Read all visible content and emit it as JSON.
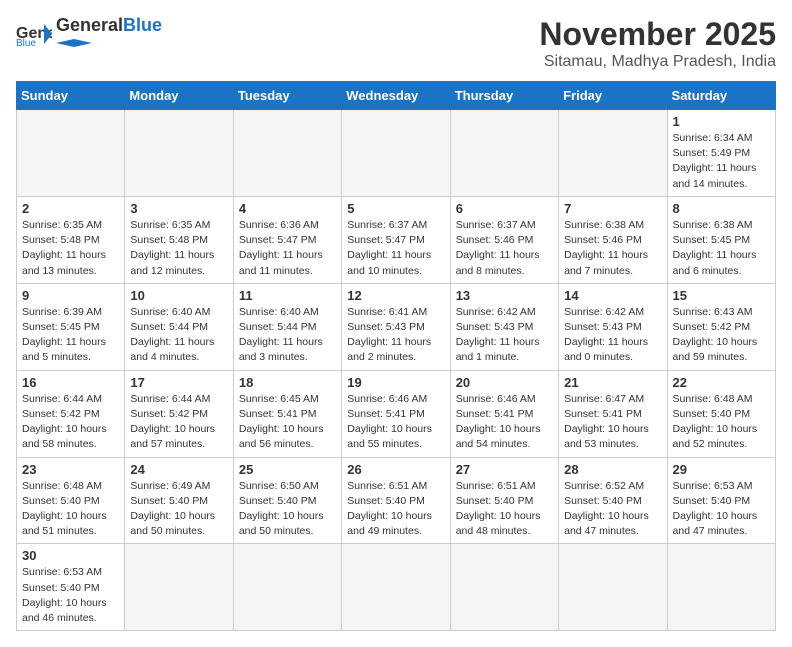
{
  "header": {
    "logo_general": "General",
    "logo_blue": "Blue",
    "month_year": "November 2025",
    "location": "Sitamau, Madhya Pradesh, India"
  },
  "weekdays": [
    "Sunday",
    "Monday",
    "Tuesday",
    "Wednesday",
    "Thursday",
    "Friday",
    "Saturday"
  ],
  "days": {
    "1": {
      "sunrise": "6:34 AM",
      "sunset": "5:49 PM",
      "daylight": "11 hours and 14 minutes."
    },
    "2": {
      "sunrise": "6:35 AM",
      "sunset": "5:48 PM",
      "daylight": "11 hours and 13 minutes."
    },
    "3": {
      "sunrise": "6:35 AM",
      "sunset": "5:48 PM",
      "daylight": "11 hours and 12 minutes."
    },
    "4": {
      "sunrise": "6:36 AM",
      "sunset": "5:47 PM",
      "daylight": "11 hours and 11 minutes."
    },
    "5": {
      "sunrise": "6:37 AM",
      "sunset": "5:47 PM",
      "daylight": "11 hours and 10 minutes."
    },
    "6": {
      "sunrise": "6:37 AM",
      "sunset": "5:46 PM",
      "daylight": "11 hours and 8 minutes."
    },
    "7": {
      "sunrise": "6:38 AM",
      "sunset": "5:46 PM",
      "daylight": "11 hours and 7 minutes."
    },
    "8": {
      "sunrise": "6:38 AM",
      "sunset": "5:45 PM",
      "daylight": "11 hours and 6 minutes."
    },
    "9": {
      "sunrise": "6:39 AM",
      "sunset": "5:45 PM",
      "daylight": "11 hours and 5 minutes."
    },
    "10": {
      "sunrise": "6:40 AM",
      "sunset": "5:44 PM",
      "daylight": "11 hours and 4 minutes."
    },
    "11": {
      "sunrise": "6:40 AM",
      "sunset": "5:44 PM",
      "daylight": "11 hours and 3 minutes."
    },
    "12": {
      "sunrise": "6:41 AM",
      "sunset": "5:43 PM",
      "daylight": "11 hours and 2 minutes."
    },
    "13": {
      "sunrise": "6:42 AM",
      "sunset": "5:43 PM",
      "daylight": "11 hours and 1 minute."
    },
    "14": {
      "sunrise": "6:42 AM",
      "sunset": "5:43 PM",
      "daylight": "11 hours and 0 minutes."
    },
    "15": {
      "sunrise": "6:43 AM",
      "sunset": "5:42 PM",
      "daylight": "10 hours and 59 minutes."
    },
    "16": {
      "sunrise": "6:44 AM",
      "sunset": "5:42 PM",
      "daylight": "10 hours and 58 minutes."
    },
    "17": {
      "sunrise": "6:44 AM",
      "sunset": "5:42 PM",
      "daylight": "10 hours and 57 minutes."
    },
    "18": {
      "sunrise": "6:45 AM",
      "sunset": "5:41 PM",
      "daylight": "10 hours and 56 minutes."
    },
    "19": {
      "sunrise": "6:46 AM",
      "sunset": "5:41 PM",
      "daylight": "10 hours and 55 minutes."
    },
    "20": {
      "sunrise": "6:46 AM",
      "sunset": "5:41 PM",
      "daylight": "10 hours and 54 minutes."
    },
    "21": {
      "sunrise": "6:47 AM",
      "sunset": "5:41 PM",
      "daylight": "10 hours and 53 minutes."
    },
    "22": {
      "sunrise": "6:48 AM",
      "sunset": "5:40 PM",
      "daylight": "10 hours and 52 minutes."
    },
    "23": {
      "sunrise": "6:48 AM",
      "sunset": "5:40 PM",
      "daylight": "10 hours and 51 minutes."
    },
    "24": {
      "sunrise": "6:49 AM",
      "sunset": "5:40 PM",
      "daylight": "10 hours and 50 minutes."
    },
    "25": {
      "sunrise": "6:50 AM",
      "sunset": "5:40 PM",
      "daylight": "10 hours and 50 minutes."
    },
    "26": {
      "sunrise": "6:51 AM",
      "sunset": "5:40 PM",
      "daylight": "10 hours and 49 minutes."
    },
    "27": {
      "sunrise": "6:51 AM",
      "sunset": "5:40 PM",
      "daylight": "10 hours and 48 minutes."
    },
    "28": {
      "sunrise": "6:52 AM",
      "sunset": "5:40 PM",
      "daylight": "10 hours and 47 minutes."
    },
    "29": {
      "sunrise": "6:53 AM",
      "sunset": "5:40 PM",
      "daylight": "10 hours and 47 minutes."
    },
    "30": {
      "sunrise": "6:53 AM",
      "sunset": "5:40 PM",
      "daylight": "10 hours and 46 minutes."
    }
  }
}
